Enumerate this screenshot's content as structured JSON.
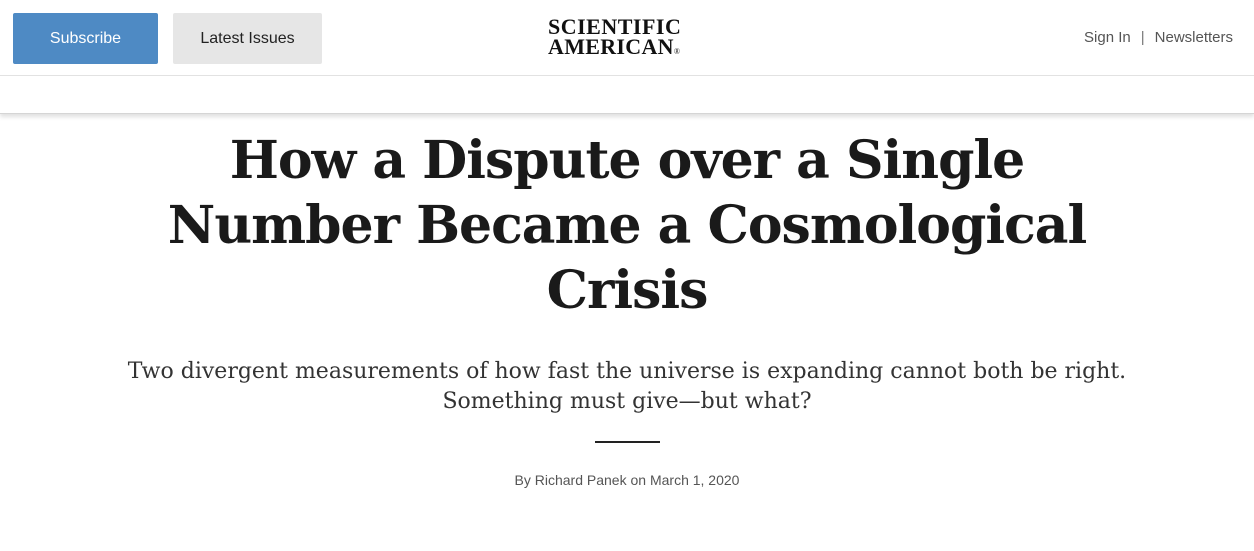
{
  "header": {
    "subscribe_label": "Subscribe",
    "latest_issues_label": "Latest Issues",
    "logo_line1": "SCIENTIFIC",
    "logo_line2": "AMERICAN",
    "logo_mark": "®",
    "sign_in_label": "Sign In",
    "separator": "|",
    "newsletters_label": "Newsletters"
  },
  "article": {
    "headline": "How a Dispute over a Single Number Became a Cosmological Crisis",
    "dek": "Two divergent measurements of how fast the universe is expanding cannot both be right. Something must give—but what?",
    "byline_prefix": "By",
    "author": "Richard Panek",
    "date_prefix": "on",
    "date": "March 1, 2020"
  },
  "colors": {
    "subscribe_bg": "#4e8ac4",
    "latest_issues_bg": "#e6e6e6",
    "headline": "#1a1a1a"
  }
}
